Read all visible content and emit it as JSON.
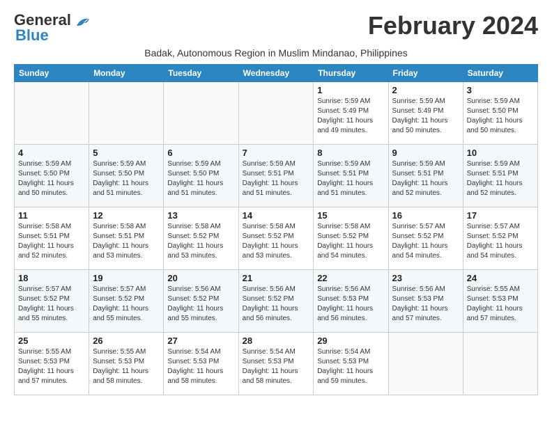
{
  "header": {
    "logo_line1": "General",
    "logo_line2": "Blue",
    "month_year": "February 2024",
    "subtitle": "Badak, Autonomous Region in Muslim Mindanao, Philippines"
  },
  "weekdays": [
    "Sunday",
    "Monday",
    "Tuesday",
    "Wednesday",
    "Thursday",
    "Friday",
    "Saturday"
  ],
  "weeks": [
    [
      {
        "day": "",
        "info": ""
      },
      {
        "day": "",
        "info": ""
      },
      {
        "day": "",
        "info": ""
      },
      {
        "day": "",
        "info": ""
      },
      {
        "day": "1",
        "info": "Sunrise: 5:59 AM\nSunset: 5:49 PM\nDaylight: 11 hours and 49 minutes."
      },
      {
        "day": "2",
        "info": "Sunrise: 5:59 AM\nSunset: 5:49 PM\nDaylight: 11 hours and 50 minutes."
      },
      {
        "day": "3",
        "info": "Sunrise: 5:59 AM\nSunset: 5:50 PM\nDaylight: 11 hours and 50 minutes."
      }
    ],
    [
      {
        "day": "4",
        "info": "Sunrise: 5:59 AM\nSunset: 5:50 PM\nDaylight: 11 hours and 50 minutes."
      },
      {
        "day": "5",
        "info": "Sunrise: 5:59 AM\nSunset: 5:50 PM\nDaylight: 11 hours and 51 minutes."
      },
      {
        "day": "6",
        "info": "Sunrise: 5:59 AM\nSunset: 5:50 PM\nDaylight: 11 hours and 51 minutes."
      },
      {
        "day": "7",
        "info": "Sunrise: 5:59 AM\nSunset: 5:51 PM\nDaylight: 11 hours and 51 minutes."
      },
      {
        "day": "8",
        "info": "Sunrise: 5:59 AM\nSunset: 5:51 PM\nDaylight: 11 hours and 51 minutes."
      },
      {
        "day": "9",
        "info": "Sunrise: 5:59 AM\nSunset: 5:51 PM\nDaylight: 11 hours and 52 minutes."
      },
      {
        "day": "10",
        "info": "Sunrise: 5:59 AM\nSunset: 5:51 PM\nDaylight: 11 hours and 52 minutes."
      }
    ],
    [
      {
        "day": "11",
        "info": "Sunrise: 5:58 AM\nSunset: 5:51 PM\nDaylight: 11 hours and 52 minutes."
      },
      {
        "day": "12",
        "info": "Sunrise: 5:58 AM\nSunset: 5:51 PM\nDaylight: 11 hours and 53 minutes."
      },
      {
        "day": "13",
        "info": "Sunrise: 5:58 AM\nSunset: 5:52 PM\nDaylight: 11 hours and 53 minutes."
      },
      {
        "day": "14",
        "info": "Sunrise: 5:58 AM\nSunset: 5:52 PM\nDaylight: 11 hours and 53 minutes."
      },
      {
        "day": "15",
        "info": "Sunrise: 5:58 AM\nSunset: 5:52 PM\nDaylight: 11 hours and 54 minutes."
      },
      {
        "day": "16",
        "info": "Sunrise: 5:57 AM\nSunset: 5:52 PM\nDaylight: 11 hours and 54 minutes."
      },
      {
        "day": "17",
        "info": "Sunrise: 5:57 AM\nSunset: 5:52 PM\nDaylight: 11 hours and 54 minutes."
      }
    ],
    [
      {
        "day": "18",
        "info": "Sunrise: 5:57 AM\nSunset: 5:52 PM\nDaylight: 11 hours and 55 minutes."
      },
      {
        "day": "19",
        "info": "Sunrise: 5:57 AM\nSunset: 5:52 PM\nDaylight: 11 hours and 55 minutes."
      },
      {
        "day": "20",
        "info": "Sunrise: 5:56 AM\nSunset: 5:52 PM\nDaylight: 11 hours and 55 minutes."
      },
      {
        "day": "21",
        "info": "Sunrise: 5:56 AM\nSunset: 5:52 PM\nDaylight: 11 hours and 56 minutes."
      },
      {
        "day": "22",
        "info": "Sunrise: 5:56 AM\nSunset: 5:53 PM\nDaylight: 11 hours and 56 minutes."
      },
      {
        "day": "23",
        "info": "Sunrise: 5:56 AM\nSunset: 5:53 PM\nDaylight: 11 hours and 57 minutes."
      },
      {
        "day": "24",
        "info": "Sunrise: 5:55 AM\nSunset: 5:53 PM\nDaylight: 11 hours and 57 minutes."
      }
    ],
    [
      {
        "day": "25",
        "info": "Sunrise: 5:55 AM\nSunset: 5:53 PM\nDaylight: 11 hours and 57 minutes."
      },
      {
        "day": "26",
        "info": "Sunrise: 5:55 AM\nSunset: 5:53 PM\nDaylight: 11 hours and 58 minutes."
      },
      {
        "day": "27",
        "info": "Sunrise: 5:54 AM\nSunset: 5:53 PM\nDaylight: 11 hours and 58 minutes."
      },
      {
        "day": "28",
        "info": "Sunrise: 5:54 AM\nSunset: 5:53 PM\nDaylight: 11 hours and 58 minutes."
      },
      {
        "day": "29",
        "info": "Sunrise: 5:54 AM\nSunset: 5:53 PM\nDaylight: 11 hours and 59 minutes."
      },
      {
        "day": "",
        "info": ""
      },
      {
        "day": "",
        "info": ""
      }
    ]
  ]
}
